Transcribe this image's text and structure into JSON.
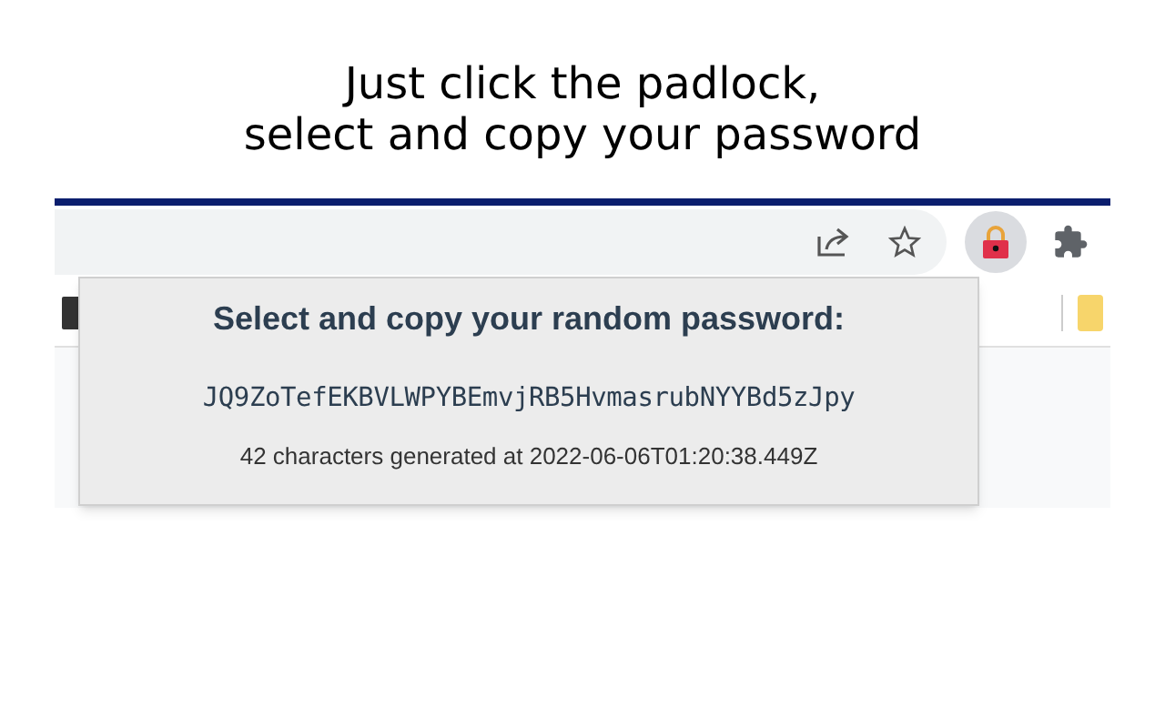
{
  "caption": [
    "Just click the padlock,",
    "select and copy your password"
  ],
  "popup": {
    "title": "Select and copy your random password:",
    "password": "JQ9ZoTefEKBVLWPYBEmvjRB5HvmasrubNYYBd5zJpy",
    "info": "42 characters generated at 2022-06-06T01:20:38.449Z"
  },
  "extension_button": {
    "selected": true
  }
}
